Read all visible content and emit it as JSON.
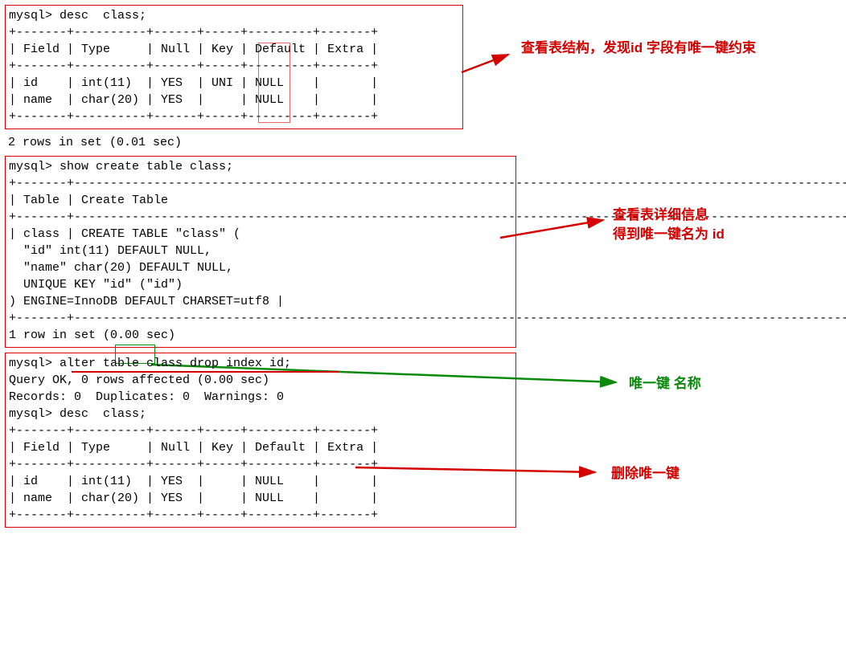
{
  "block1": {
    "line1": "mysql> desc  class;",
    "line2": "+-------+----------+------+-----+---------+-------+",
    "line3": "| Field | Type     | Null | Key | Default | Extra |",
    "line4": "+-------+----------+------+-----+---------+-------+",
    "line5": "| id    | int(11)  | YES  | UNI | NULL    |       |",
    "line6": "| name  | char(20) | YES  |     | NULL    |       |",
    "line7": "+-------+----------+------+-----+---------+-------+"
  },
  "after1": "2 rows in set (0.01 sec)",
  "block2": {
    "l1": "mysql> show create table class;",
    "l2": "+-------+---------------------------------------------------------------------------------------------------------------------------------+",
    "l3": "| Table | Create Table                                                                                                                    |",
    "l4": "+-------+---------------------------------------------------------------------------------------------------------------------------------+",
    "l5": "| class | CREATE TABLE \"class\" (",
    "l6": "  \"id\" int(11) DEFAULT NULL,",
    "l7": "  \"name\" char(20) DEFAULT NULL,",
    "l8": "  UNIQUE KEY \"id\" (\"id\")",
    "l9": ") ENGINE=InnoDB DEFAULT CHARSET=utf8 |",
    "l10": "+-------+---------------------------------------------------------------------------------------------------------------------------------+",
    "l11": "1 row in set (0.00 sec)"
  },
  "block3": {
    "l1": "mysql> alter table class drop index id;",
    "l2": "Query OK, 0 rows affected (0.00 sec)",
    "l3": "Records: 0  Duplicates: 0  Warnings: 0",
    "l4": "",
    "l5": "mysql> desc  class;",
    "l6": "+-------+----------+------+-----+---------+-------+",
    "l7": "| Field | Type     | Null | Key | Default | Extra |",
    "l8": "+-------+----------+------+-----+---------+-------+",
    "l9": "| id    | int(11)  | YES  |     | NULL    |       |",
    "l10": "| name  | char(20) | YES  |     | NULL    |       |",
    "l11": "+-------+----------+------+-----+---------+-------+"
  },
  "annot1": "查看表结构，发现id 字段有唯一键约束",
  "annot2a": "查看表详细信息",
  "annot2b": "得到唯一键名为 id",
  "annot3": "唯一键 名称",
  "annot4": "删除唯一键"
}
